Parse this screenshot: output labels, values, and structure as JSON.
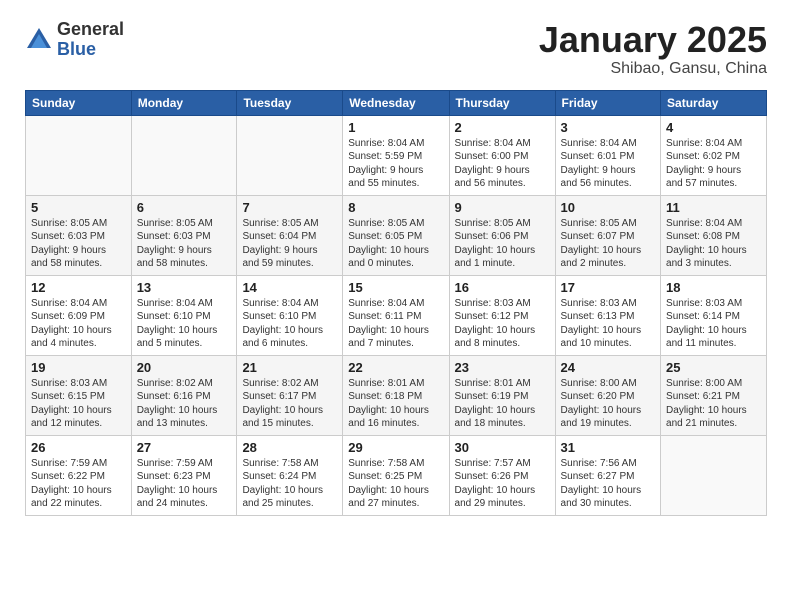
{
  "logo": {
    "general": "General",
    "blue": "Blue"
  },
  "title": "January 2025",
  "subtitle": "Shibao, Gansu, China",
  "days_header": [
    "Sunday",
    "Monday",
    "Tuesday",
    "Wednesday",
    "Thursday",
    "Friday",
    "Saturday"
  ],
  "weeks": [
    [
      {
        "num": "",
        "info": ""
      },
      {
        "num": "",
        "info": ""
      },
      {
        "num": "",
        "info": ""
      },
      {
        "num": "1",
        "info": "Sunrise: 8:04 AM\nSunset: 5:59 PM\nDaylight: 9 hours\nand 55 minutes."
      },
      {
        "num": "2",
        "info": "Sunrise: 8:04 AM\nSunset: 6:00 PM\nDaylight: 9 hours\nand 56 minutes."
      },
      {
        "num": "3",
        "info": "Sunrise: 8:04 AM\nSunset: 6:01 PM\nDaylight: 9 hours\nand 56 minutes."
      },
      {
        "num": "4",
        "info": "Sunrise: 8:04 AM\nSunset: 6:02 PM\nDaylight: 9 hours\nand 57 minutes."
      }
    ],
    [
      {
        "num": "5",
        "info": "Sunrise: 8:05 AM\nSunset: 6:03 PM\nDaylight: 9 hours\nand 58 minutes."
      },
      {
        "num": "6",
        "info": "Sunrise: 8:05 AM\nSunset: 6:03 PM\nDaylight: 9 hours\nand 58 minutes."
      },
      {
        "num": "7",
        "info": "Sunrise: 8:05 AM\nSunset: 6:04 PM\nDaylight: 9 hours\nand 59 minutes."
      },
      {
        "num": "8",
        "info": "Sunrise: 8:05 AM\nSunset: 6:05 PM\nDaylight: 10 hours\nand 0 minutes."
      },
      {
        "num": "9",
        "info": "Sunrise: 8:05 AM\nSunset: 6:06 PM\nDaylight: 10 hours\nand 1 minute."
      },
      {
        "num": "10",
        "info": "Sunrise: 8:05 AM\nSunset: 6:07 PM\nDaylight: 10 hours\nand 2 minutes."
      },
      {
        "num": "11",
        "info": "Sunrise: 8:04 AM\nSunset: 6:08 PM\nDaylight: 10 hours\nand 3 minutes."
      }
    ],
    [
      {
        "num": "12",
        "info": "Sunrise: 8:04 AM\nSunset: 6:09 PM\nDaylight: 10 hours\nand 4 minutes."
      },
      {
        "num": "13",
        "info": "Sunrise: 8:04 AM\nSunset: 6:10 PM\nDaylight: 10 hours\nand 5 minutes."
      },
      {
        "num": "14",
        "info": "Sunrise: 8:04 AM\nSunset: 6:10 PM\nDaylight: 10 hours\nand 6 minutes."
      },
      {
        "num": "15",
        "info": "Sunrise: 8:04 AM\nSunset: 6:11 PM\nDaylight: 10 hours\nand 7 minutes."
      },
      {
        "num": "16",
        "info": "Sunrise: 8:03 AM\nSunset: 6:12 PM\nDaylight: 10 hours\nand 8 minutes."
      },
      {
        "num": "17",
        "info": "Sunrise: 8:03 AM\nSunset: 6:13 PM\nDaylight: 10 hours\nand 10 minutes."
      },
      {
        "num": "18",
        "info": "Sunrise: 8:03 AM\nSunset: 6:14 PM\nDaylight: 10 hours\nand 11 minutes."
      }
    ],
    [
      {
        "num": "19",
        "info": "Sunrise: 8:03 AM\nSunset: 6:15 PM\nDaylight: 10 hours\nand 12 minutes."
      },
      {
        "num": "20",
        "info": "Sunrise: 8:02 AM\nSunset: 6:16 PM\nDaylight: 10 hours\nand 13 minutes."
      },
      {
        "num": "21",
        "info": "Sunrise: 8:02 AM\nSunset: 6:17 PM\nDaylight: 10 hours\nand 15 minutes."
      },
      {
        "num": "22",
        "info": "Sunrise: 8:01 AM\nSunset: 6:18 PM\nDaylight: 10 hours\nand 16 minutes."
      },
      {
        "num": "23",
        "info": "Sunrise: 8:01 AM\nSunset: 6:19 PM\nDaylight: 10 hours\nand 18 minutes."
      },
      {
        "num": "24",
        "info": "Sunrise: 8:00 AM\nSunset: 6:20 PM\nDaylight: 10 hours\nand 19 minutes."
      },
      {
        "num": "25",
        "info": "Sunrise: 8:00 AM\nSunset: 6:21 PM\nDaylight: 10 hours\nand 21 minutes."
      }
    ],
    [
      {
        "num": "26",
        "info": "Sunrise: 7:59 AM\nSunset: 6:22 PM\nDaylight: 10 hours\nand 22 minutes."
      },
      {
        "num": "27",
        "info": "Sunrise: 7:59 AM\nSunset: 6:23 PM\nDaylight: 10 hours\nand 24 minutes."
      },
      {
        "num": "28",
        "info": "Sunrise: 7:58 AM\nSunset: 6:24 PM\nDaylight: 10 hours\nand 25 minutes."
      },
      {
        "num": "29",
        "info": "Sunrise: 7:58 AM\nSunset: 6:25 PM\nDaylight: 10 hours\nand 27 minutes."
      },
      {
        "num": "30",
        "info": "Sunrise: 7:57 AM\nSunset: 6:26 PM\nDaylight: 10 hours\nand 29 minutes."
      },
      {
        "num": "31",
        "info": "Sunrise: 7:56 AM\nSunset: 6:27 PM\nDaylight: 10 hours\nand 30 minutes."
      },
      {
        "num": "",
        "info": ""
      }
    ]
  ]
}
